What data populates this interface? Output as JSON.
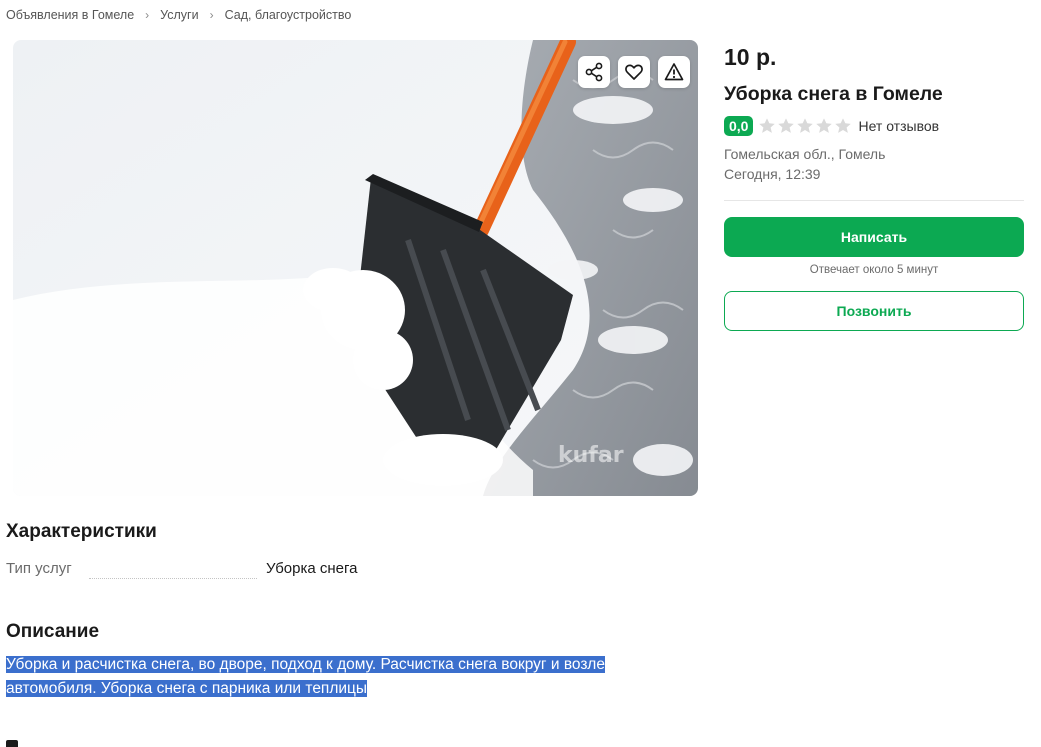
{
  "breadcrumb": {
    "items": [
      "Объявления в Гомеле",
      "Услуги",
      "Сад, благоустройство"
    ],
    "separator": "›"
  },
  "listing": {
    "price": "10 р.",
    "title": "Уборка снега в Гомеле",
    "rating": "0,0",
    "stars_filled": 0,
    "stars_total": 5,
    "reviews": "Нет отзывов",
    "location": "Гомельская обл., Гомель",
    "date": "Сегодня, 12:39"
  },
  "photo": {
    "actions": [
      "share-icon",
      "heart-icon",
      "warning-icon"
    ],
    "watermark": "kufar"
  },
  "contact": {
    "write_label": "Написать",
    "reply_time": "Отвечает около 5 минут",
    "call_label": "Позвонить"
  },
  "specs": {
    "heading": "Характеристики",
    "rows": [
      {
        "label": "Тип услуг",
        "value": "Уборка снега"
      }
    ]
  },
  "description": {
    "heading": "Описание",
    "text": "Уборка и расчистка снега, во дворе, подход к дому. Расчистка снега вокруг и возле автомобиля. Уборка снега с парника или теплицы"
  },
  "colors": {
    "accent": "#0ca952",
    "selection": "#3b6fcd",
    "muted_text": "#6b6b6b"
  }
}
